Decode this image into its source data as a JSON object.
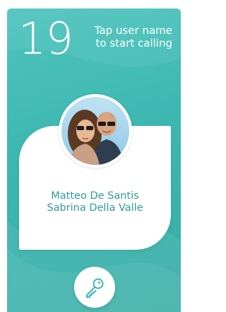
{
  "header": {
    "count": "19",
    "instruction_line1": "Tap user name",
    "instruction_line2": "to start calling"
  },
  "user": {
    "name_line1": "Matteo De Santis",
    "name_line2": "Sabrina Della Valle",
    "avatar_icon": "couple-photo"
  },
  "actions": {
    "key_icon": "key-icon"
  },
  "colors": {
    "background": "#3cb7b0",
    "card": "#ffffff",
    "name_text": "#2f9a9a",
    "icon": "#3cb7b0"
  }
}
